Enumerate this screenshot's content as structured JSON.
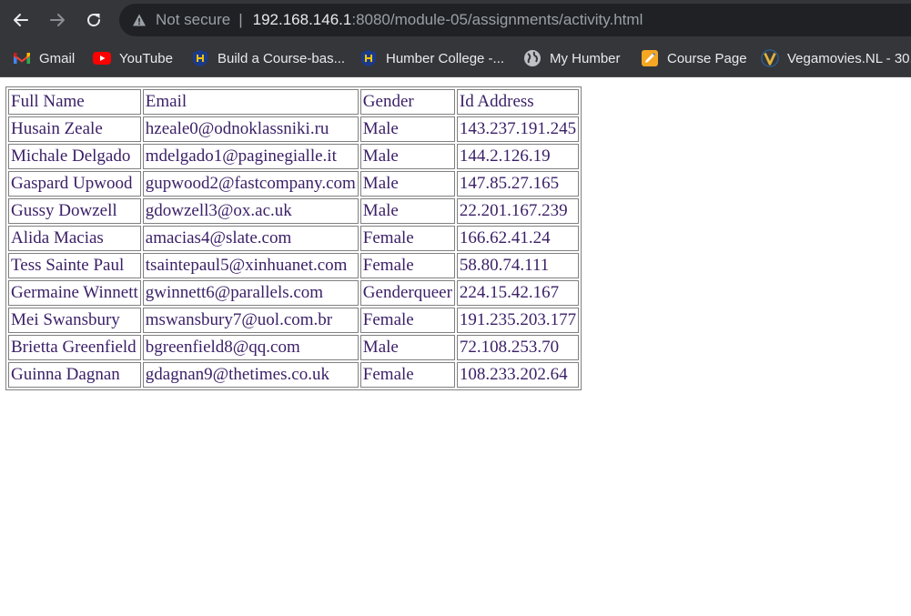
{
  "browser": {
    "nav": {
      "back_icon": "arrow-left-icon",
      "forward_icon": "arrow-right-icon",
      "reload_icon": "reload-icon"
    },
    "address_bar": {
      "security_label": "Not secure",
      "host": "192.168.146.1",
      "path": ":8080/module-05/assignments/activity.html"
    },
    "bookmarks": [
      {
        "label": "Gmail",
        "icon": "gmail-icon"
      },
      {
        "label": "YouTube",
        "icon": "youtube-icon"
      },
      {
        "label": "Build a Course-bas...",
        "icon": "humber-icon"
      },
      {
        "label": "Humber College -...",
        "icon": "humber-icon"
      },
      {
        "label": "My Humber",
        "icon": "globe-icon"
      },
      {
        "label": "Course Page",
        "icon": "course-page-icon"
      },
      {
        "label": "Vegamovies.NL - 30...",
        "icon": "vegamovies-icon"
      }
    ]
  },
  "colors": {
    "chrome_bg": "#35363a",
    "omnibox_bg": "#202124",
    "table_text": "#3a1f66",
    "table_border": "#808080"
  },
  "table": {
    "headers": [
      "Full Name",
      "Email",
      "Gender",
      "Id Address"
    ],
    "rows": [
      [
        "Husain Zeale",
        "hzeale0@odnoklassniki.ru",
        "Male",
        "143.237.191.245"
      ],
      [
        "Michale Delgado",
        "mdelgado1@paginegialle.it",
        "Male",
        "144.2.126.19"
      ],
      [
        "Gaspard Upwood",
        "gupwood2@fastcompany.com",
        "Male",
        "147.85.27.165"
      ],
      [
        "Gussy Dowzell",
        "gdowzell3@ox.ac.uk",
        "Male",
        "22.201.167.239"
      ],
      [
        "Alida Macias",
        "amacias4@slate.com",
        "Female",
        "166.62.41.24"
      ],
      [
        "Tess Sainte Paul",
        "tsaintepaul5@xinhuanet.com",
        "Female",
        "58.80.74.111"
      ],
      [
        "Germaine Winnett",
        "gwinnett6@parallels.com",
        "Genderqueer",
        "224.15.42.167"
      ],
      [
        "Mei Swansbury",
        "mswansbury7@uol.com.br",
        "Female",
        "191.235.203.177"
      ],
      [
        "Brietta Greenfield",
        "bgreenfield8@qq.com",
        "Male",
        "72.108.253.70"
      ],
      [
        "Guinna Dagnan",
        "gdagnan9@thetimes.co.uk",
        "Female",
        "108.233.202.64"
      ]
    ]
  }
}
